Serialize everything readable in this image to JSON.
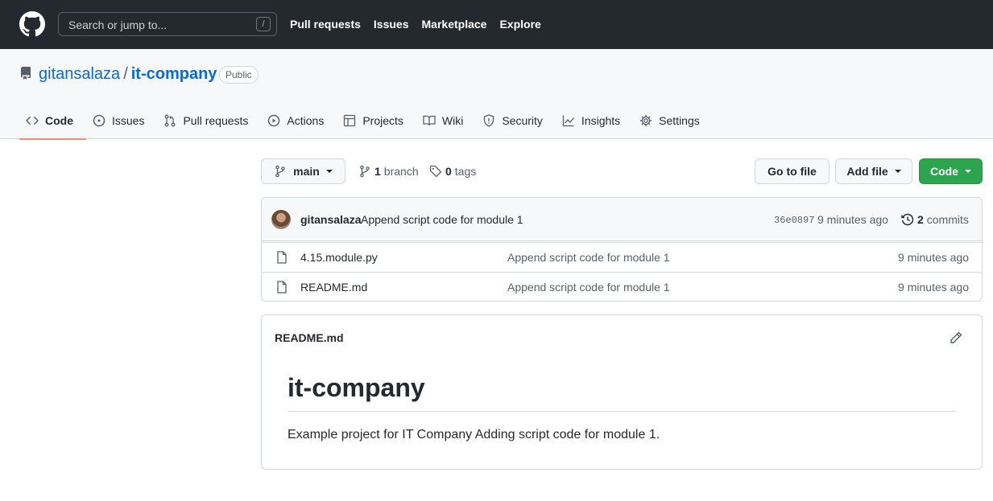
{
  "header": {
    "search_placeholder": "Search or jump to...",
    "search_shortcut": "/",
    "nav": [
      "Pull requests",
      "Issues",
      "Marketplace",
      "Explore"
    ]
  },
  "repo": {
    "owner": "gitansalaza",
    "separator": "/",
    "name": "it-company",
    "visibility": "Public"
  },
  "tabs": [
    {
      "label": "Code",
      "icon": "code-icon",
      "active": true
    },
    {
      "label": "Issues",
      "icon": "issue-icon"
    },
    {
      "label": "Pull requests",
      "icon": "pull-request-icon"
    },
    {
      "label": "Actions",
      "icon": "play-icon"
    },
    {
      "label": "Projects",
      "icon": "table-icon"
    },
    {
      "label": "Wiki",
      "icon": "book-icon"
    },
    {
      "label": "Security",
      "icon": "shield-icon"
    },
    {
      "label": "Insights",
      "icon": "graph-icon"
    },
    {
      "label": "Settings",
      "icon": "gear-icon"
    }
  ],
  "toolbar": {
    "branch": "main",
    "branch_count": "1",
    "branch_label": "branch",
    "tag_count": "0",
    "tag_label": "tags",
    "go_to_file": "Go to file",
    "add_file": "Add file",
    "code": "Code"
  },
  "latest_commit": {
    "author": "gitansalaza",
    "message": "Append script code for module 1",
    "sha": "36e0897",
    "time": "9 minutes ago",
    "commit_count": "2",
    "commit_label": "commits"
  },
  "files": [
    {
      "name": "4.15.module.py",
      "message": "Append script code for module 1",
      "time": "9 minutes ago"
    },
    {
      "name": "README.md",
      "message": "Append script code for module 1",
      "time": "9 minutes ago"
    }
  ],
  "readme": {
    "filename": "README.md",
    "heading": "it-company",
    "body": "Example project for IT Company Adding script code for module 1."
  },
  "colors": {
    "header_bg": "#24292f",
    "link": "#0969da",
    "primary_button": "#2da44e",
    "active_tab_underline": "#fd8c73"
  }
}
